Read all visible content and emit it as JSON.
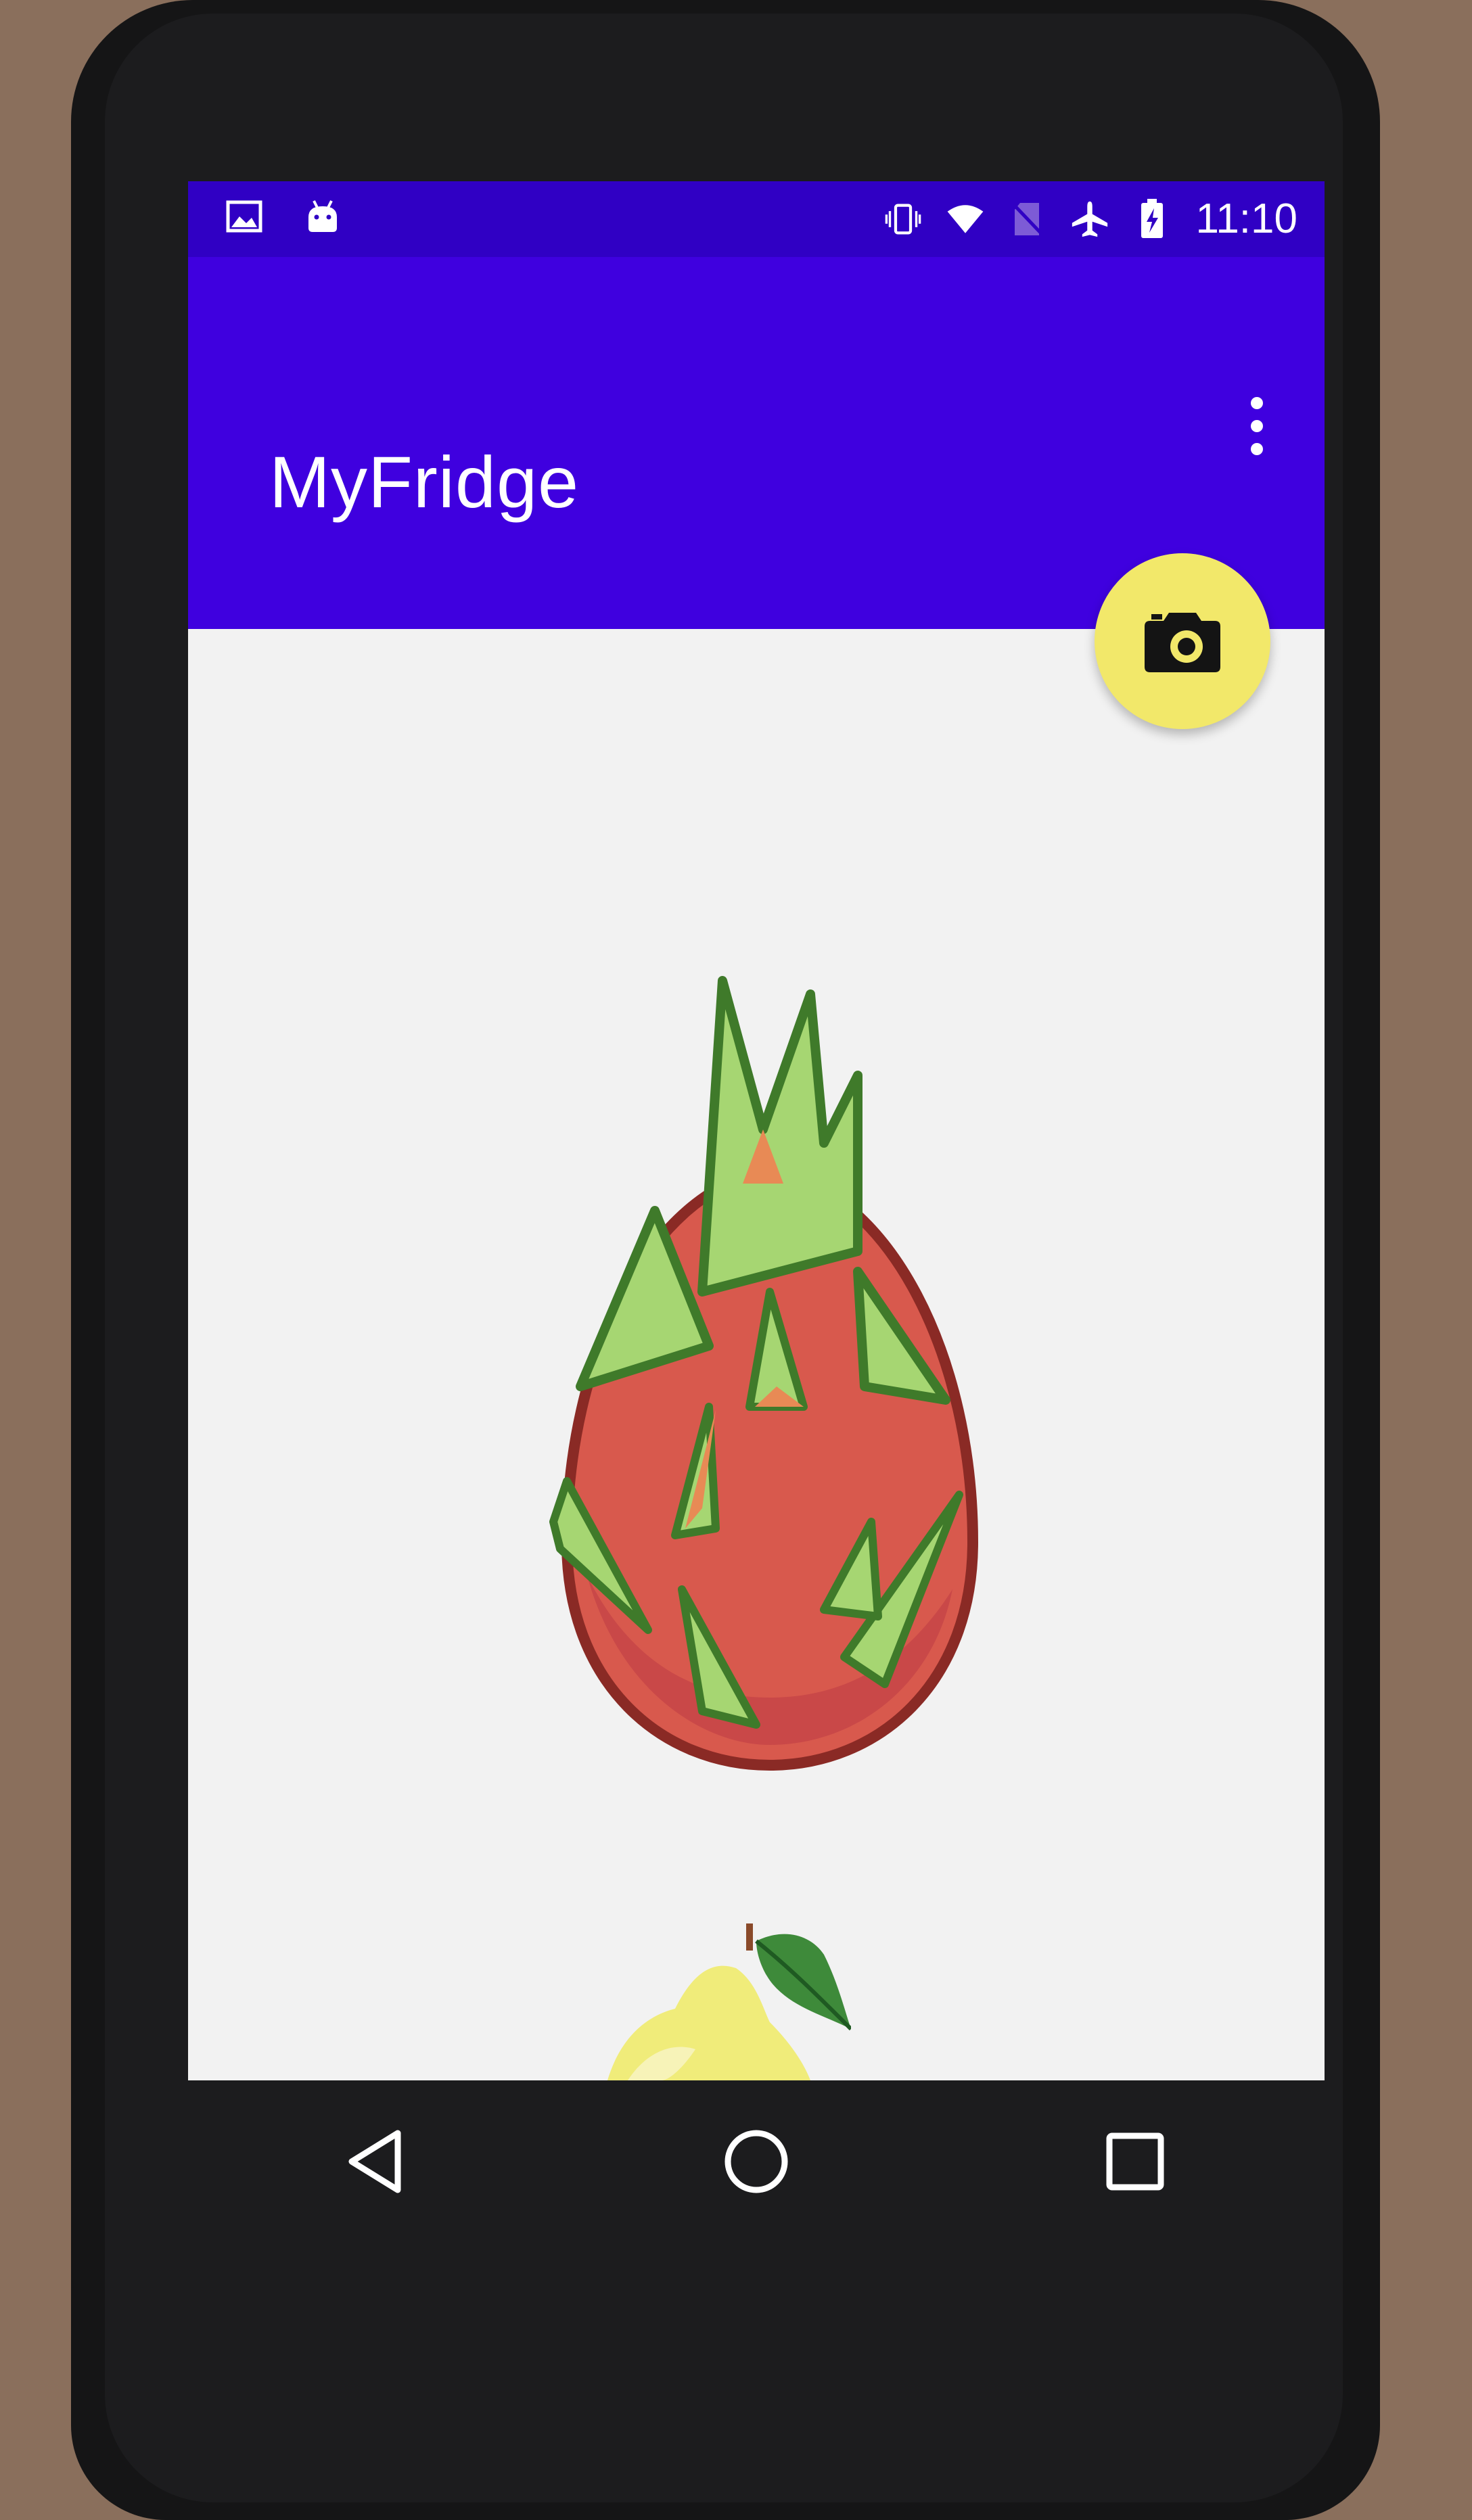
{
  "status_bar": {
    "time": "11:10",
    "icons_left": [
      "image-notification-icon",
      "android-debug-icon"
    ],
    "icons_right": [
      "vibrate-icon",
      "wifi-icon",
      "no-sim-icon",
      "airplane-mode-icon",
      "battery-charging-icon"
    ]
  },
  "app_bar": {
    "title": "MyFridge",
    "overflow_icon": "more-vert-icon"
  },
  "fab": {
    "icon": "camera-icon",
    "color": "#f2e86a"
  },
  "content": {
    "items": [
      {
        "name": "dragon-fruit"
      },
      {
        "name": "pear"
      }
    ]
  },
  "nav_bar": {
    "buttons": [
      "back",
      "home",
      "recents"
    ]
  },
  "colors": {
    "status_bar": "#3000c4",
    "app_bar": "#3f00df",
    "background": "#f2f2f2"
  }
}
